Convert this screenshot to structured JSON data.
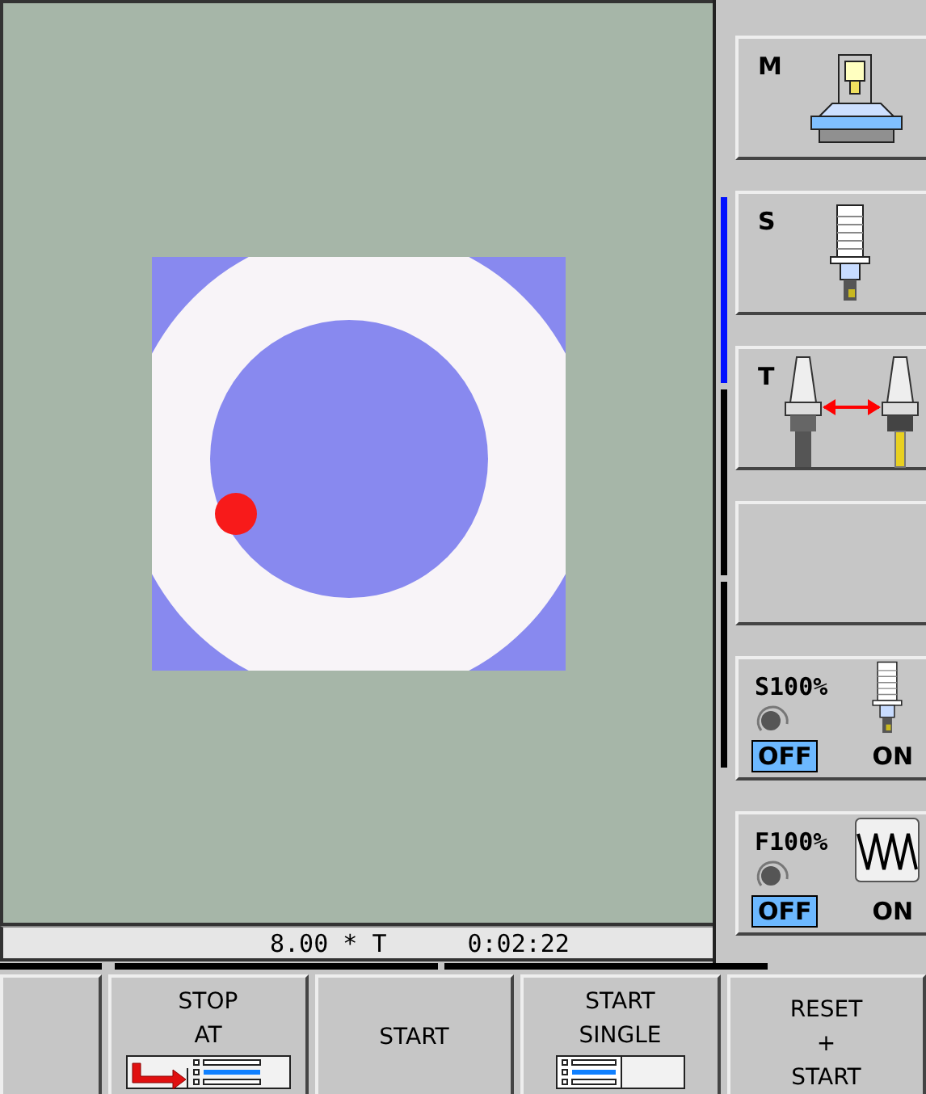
{
  "status_bar": {
    "value": "8.00 * T",
    "time": "0:02:22"
  },
  "side_keys": [
    {
      "kind": "machine",
      "label": "M"
    },
    {
      "kind": "spindle",
      "label": "S"
    },
    {
      "kind": "toolchange",
      "label": "T"
    },
    {
      "kind": "blank"
    },
    {
      "kind": "spindle-override",
      "label": "S100%",
      "options": [
        {
          "label": "OFF",
          "selected": true
        },
        {
          "label": "ON",
          "selected": false
        }
      ]
    },
    {
      "kind": "feed-override",
      "label": "F100%",
      "options": [
        {
          "label": "OFF",
          "selected": true
        },
        {
          "label": "ON",
          "selected": false
        }
      ]
    }
  ],
  "soft_keys": [
    {
      "kind": "blank"
    },
    {
      "kind": "stop-at",
      "lines": [
        "STOP",
        "AT"
      ]
    },
    {
      "kind": "text",
      "lines": [
        "START"
      ]
    },
    {
      "kind": "single-block",
      "lines": [
        "START",
        "SINGLE"
      ]
    },
    {
      "kind": "text",
      "lines": [
        "RESET",
        "+",
        "START"
      ]
    }
  ]
}
